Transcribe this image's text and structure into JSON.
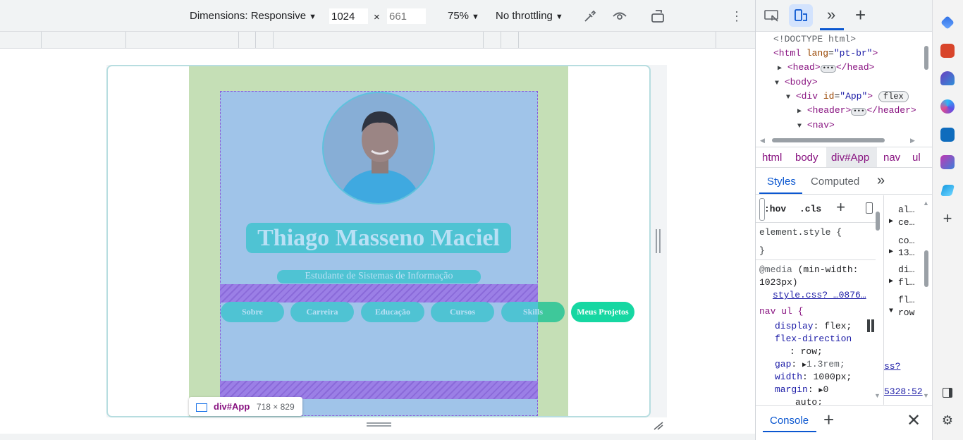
{
  "device_toolbar": {
    "dimensions_label": "Dimensions: Responsive",
    "width_value": "1024",
    "times_sign": "×",
    "height_placeholder": "661",
    "zoom": "75%",
    "throttling": "No throttling"
  },
  "page": {
    "name": "Thiago Masseno Maciel",
    "subtitle": "Estudante de Sistemas de Informação",
    "nav_items": [
      "Sobre",
      "Carreira",
      "Educação",
      "Cursos",
      "Skills",
      "Meus Projetos"
    ]
  },
  "tooltip": {
    "selector": "div#App",
    "size": "718 × 829"
  },
  "devtools": {
    "dom": {
      "doctype": "<!DOCTYPE html>",
      "html_open": "<html",
      "html_lang_attr": "lang",
      "html_lang_val": "\"pt-br\"",
      "head": "<head>",
      "head_close": "</head>",
      "body": "<body>",
      "div_open": "<div",
      "div_id_attr": "id",
      "div_id_val": "\"App\"",
      "flex_badge": "flex",
      "header": "<header>",
      "header_close": "</header>",
      "nav": "<nav>"
    },
    "breadcrumbs": [
      "html",
      "body",
      "div#App",
      "nav",
      "ul"
    ],
    "styles_tabs": [
      "Styles",
      "Computed"
    ],
    "filter": {
      "hov": ":hov",
      "cls": ".cls"
    },
    "styles": {
      "element_style": "element.style {",
      "close_brace": "}",
      "media_kw": "@media",
      "media_q1": " (min-width:",
      "media_q2": "1023px)",
      "source": "style.css?_…0876…",
      "selector": "nav ul {",
      "p1": "display",
      "v1": "flex;",
      "p2": "flex-direction",
      "v2": ": row;",
      "p3": "gap",
      "v3": "1.3rem;",
      "p4": "width",
      "v4": "1000px;",
      "p5": "margin",
      "v5": "0",
      "p6": "auto;"
    },
    "computed_side": [
      {
        "prop": "al…",
        "val": "ce…"
      },
      {
        "prop": "co…",
        "val": "13…"
      },
      {
        "prop": "di…",
        "val": "fl…"
      },
      {
        "prop": "fl…",
        "val": "row"
      }
    ],
    "side_links": [
      "ss?",
      "5328:52"
    ],
    "console_tab": "Console"
  },
  "colors": {
    "devtools_accent": "#0b57d0",
    "margin_overlay": "#c5dfb6",
    "content_overlay": "#a0c4e9",
    "nav_pill": "#4fc3d3",
    "projects_pill": "#16d7a2"
  }
}
